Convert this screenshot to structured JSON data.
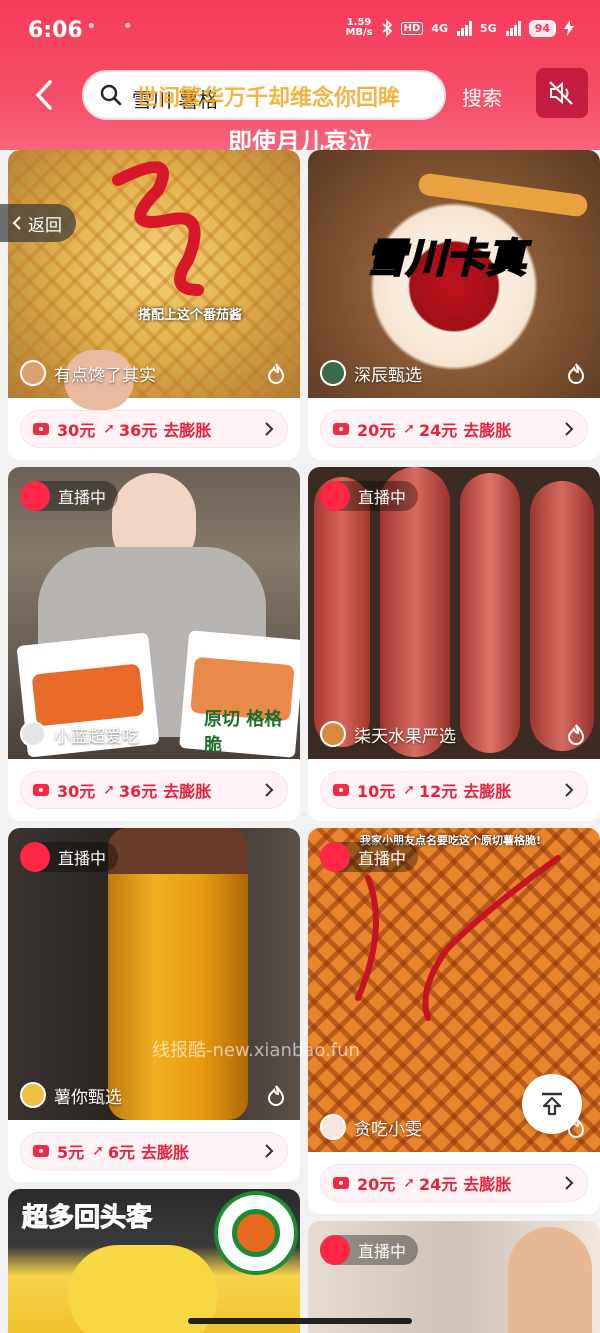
{
  "status": {
    "time": "6:06",
    "dots": "• •",
    "speed_top": "1.59",
    "speed_unit": "MB/s",
    "hd": "HD",
    "net1": "4G",
    "net2": "5G",
    "battery": "94"
  },
  "search": {
    "query": "雪川 薯格",
    "overlay_text": "世间繁华万千却维念你回眸",
    "button": "搜索"
  },
  "caption": "即使月儿哀泣",
  "return_label": "返回",
  "watermark": "线报酷-new.xianbao.fun",
  "cards": [
    {
      "author": "有点馋了其实",
      "price_from": "30元",
      "price_to": "36元",
      "action": "去膨胀",
      "thumb_text": "搭配上这个番茄酱"
    },
    {
      "author": "深辰甄选",
      "price_from": "20元",
      "price_to": "24元",
      "action": "去膨胀",
      "thumb_text": "雪川卡真"
    },
    {
      "live": "直播中",
      "author": "小蓝超爱吃",
      "price_from": "30元",
      "price_to": "36元",
      "action": "去膨胀",
      "thumb_text": "原切 格格脆"
    },
    {
      "live": "直播中",
      "author": "柒天水果严选",
      "price_from": "10元",
      "price_to": "12元",
      "action": "去膨胀"
    },
    {
      "live": "直播中",
      "author": "薯你甄选",
      "price_from": "5元",
      "price_to": "6元",
      "action": "去膨胀"
    },
    {
      "live": "直播中",
      "author": "贪吃小雯",
      "price_from": "20元",
      "price_to": "24元",
      "action": "去膨胀",
      "thumb_text": "我家小朋友点名要吃这个原切薯格脆!"
    },
    {
      "thumb_text": "超多回头客"
    },
    {
      "live": "直播中"
    }
  ],
  "colors": {
    "accent": "#f53c5a",
    "price": "#e8223c"
  }
}
